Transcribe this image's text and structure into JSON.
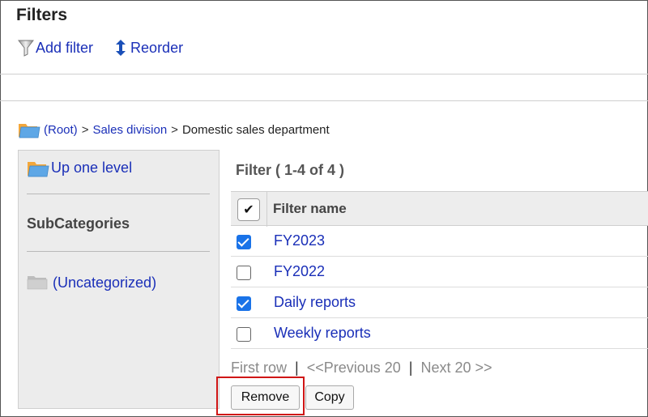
{
  "page": {
    "title": "Filters"
  },
  "toolbar": {
    "add_filter": "Add filter",
    "reorder": "Reorder"
  },
  "breadcrumb": {
    "root": "(Root)",
    "sep": ">",
    "division": "Sales division",
    "current": "Domestic sales department"
  },
  "sidebar": {
    "up_one_level": "Up one level",
    "subcategories_heading": "SubCategories",
    "uncategorized": "(Uncategorized)"
  },
  "filter_list": {
    "title": "Filter ( 1-4 of 4 )",
    "header_check": "✔",
    "column_name": "Filter name",
    "rows": [
      {
        "name": "FY2023",
        "checked": true
      },
      {
        "name": "FY2022",
        "checked": false
      },
      {
        "name": "Daily reports",
        "checked": true
      },
      {
        "name": "Weekly reports",
        "checked": false
      }
    ]
  },
  "pager": {
    "first": "First row",
    "prev": "<<Previous 20",
    "next": "Next 20 >>",
    "sep": "|"
  },
  "actions": {
    "remove": "Remove",
    "copy": "Copy"
  },
  "colors": {
    "link": "#1a2fb8",
    "checkbox": "#1a73e8",
    "highlight": "#d01616",
    "panel": "#ececec"
  },
  "icons": {
    "add_filter": "funnel-icon",
    "reorder": "up-down-arrow-icon",
    "folder": "folder-icon"
  }
}
